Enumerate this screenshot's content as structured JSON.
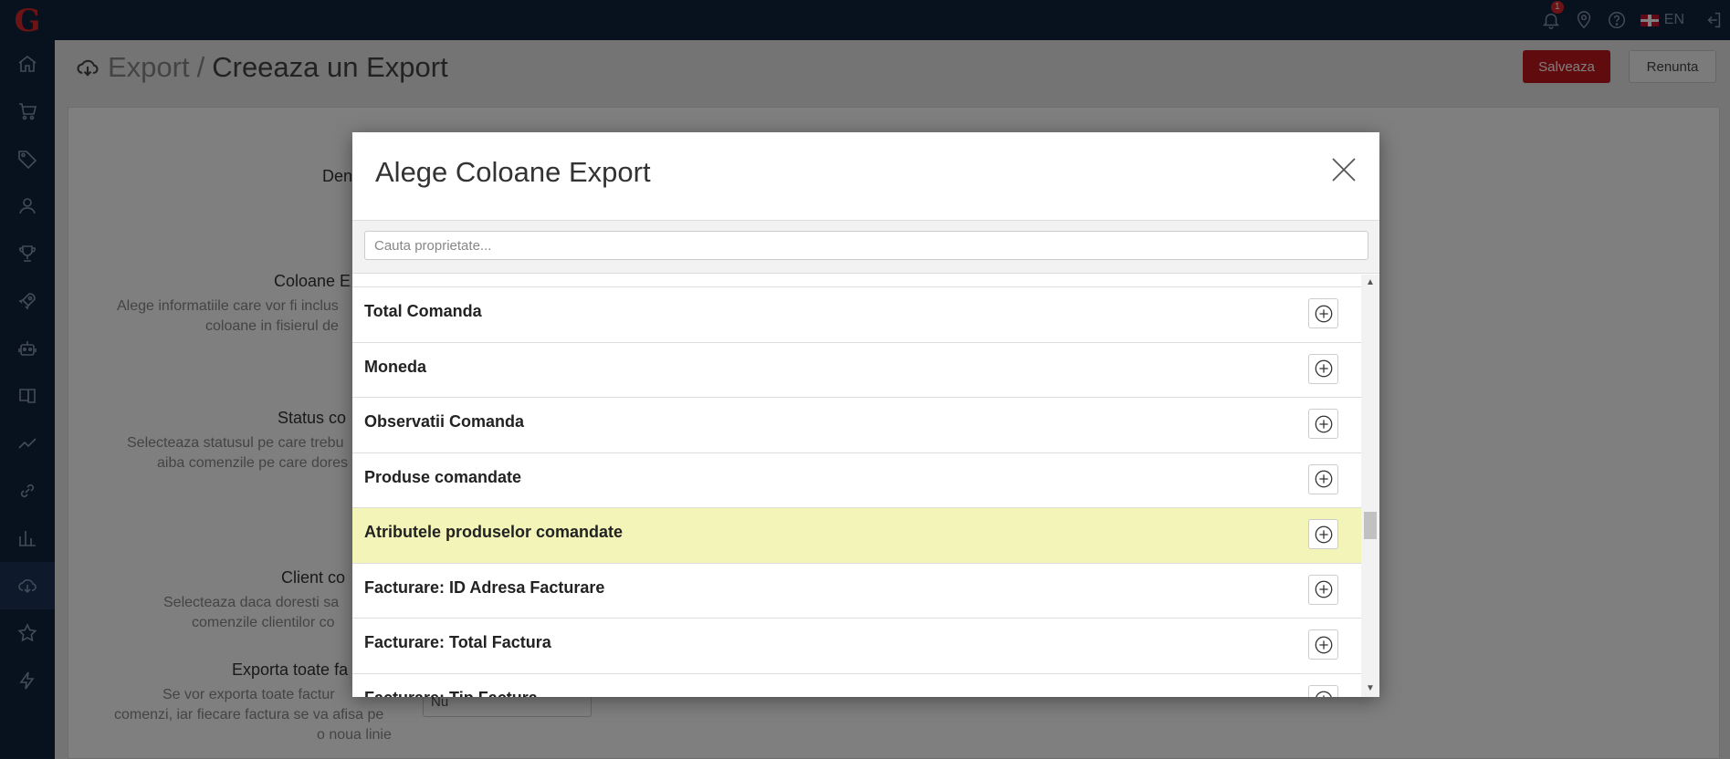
{
  "app": {
    "logo_icon": "logo-g-icon"
  },
  "topbar": {
    "notifications_count": "1",
    "language": "EN",
    "icons": [
      "bell-icon",
      "location-pin-icon",
      "help-icon",
      "flag-uk-icon",
      "logout-icon"
    ]
  },
  "sidebar": {
    "items": [
      {
        "icon": "home-icon"
      },
      {
        "icon": "cart-icon"
      },
      {
        "icon": "tag-icon"
      },
      {
        "icon": "user-icon"
      },
      {
        "icon": "trophy-icon"
      },
      {
        "icon": "rocket-icon"
      },
      {
        "icon": "robot-icon"
      },
      {
        "icon": "book-icon"
      },
      {
        "icon": "trend-icon"
      },
      {
        "icon": "link-icon"
      },
      {
        "icon": "bar-chart-icon"
      },
      {
        "icon": "cloud-download-icon",
        "active": true
      },
      {
        "icon": "star-icon"
      },
      {
        "icon": "bolt-icon"
      }
    ]
  },
  "header": {
    "breadcrumb_root": "Export",
    "breadcrumb_separator": "/",
    "breadcrumb_current": "Creeaza un Export",
    "save_label": "Salveaza",
    "cancel_label": "Renunta"
  },
  "form": {
    "name_label": "Den",
    "columns_label": "Coloane E",
    "columns_help_1": "Alege informatiile care vor fi inclus",
    "columns_help_2": "coloane in fisierul de",
    "status_label": "Status co",
    "status_help_1": "Selecteaza statusul pe care trebu",
    "status_help_2": "aiba comenzile pe care dores",
    "client_label": "Client co",
    "client_help_1": "Selecteaza daca doresti sa",
    "client_help_2": "comenzile clientilor co",
    "invoices_label": "Exporta toate fa",
    "invoices_help_1": "Se vor exporta toate factur",
    "invoices_help_2": "comenzi, iar fiecare factura se va afisa pe",
    "invoices_help_3": "o noua linie",
    "invoices_select_value": "Nu"
  },
  "modal": {
    "title": "Alege Coloane Export",
    "search_placeholder": "Cauta proprietate...",
    "items": [
      {
        "label": "Total Comanda"
      },
      {
        "label": "Moneda"
      },
      {
        "label": "Observatii Comanda"
      },
      {
        "label": "Produse comandate"
      },
      {
        "label": "Atributele produselor comandate",
        "highlighted": true
      },
      {
        "label": "Facturare: ID Adresa Facturare"
      },
      {
        "label": "Facturare: Total Factura"
      },
      {
        "label": "Facturare: Tip Factura"
      }
    ],
    "add_icon": "plus-circle-icon",
    "close_icon": "close-icon"
  },
  "colors": {
    "topbar": "#10243f",
    "brand_red": "#c0171c",
    "highlight_row": "#f3f4b7"
  }
}
